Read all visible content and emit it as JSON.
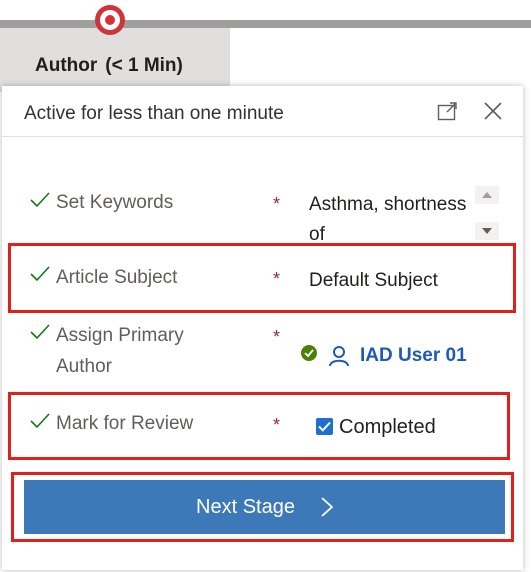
{
  "stage": {
    "tab_name": "Author",
    "tab_duration": "(< 1 Min)"
  },
  "flyout": {
    "title": "Active for less than one minute",
    "popout_icon": "popout-icon",
    "close_icon": "close-icon"
  },
  "steps": [
    {
      "label": "Set Keywords",
      "required": "*",
      "value": "Asthma, shortness of"
    },
    {
      "label": "Article Subject",
      "required": "*",
      "value": "Default Subject"
    },
    {
      "label": "Assign Primary",
      "label_line2": "Author",
      "required": "*",
      "value": "IAD User 01"
    },
    {
      "label": "Mark for Review",
      "required": "*",
      "value": "Completed",
      "checked": true
    }
  ],
  "next_stage_label": "Next Stage",
  "colors": {
    "accent": "#3d79b8",
    "highlight": "#e0201b",
    "check": "#107c10",
    "user_link": "#1f5ab8"
  }
}
